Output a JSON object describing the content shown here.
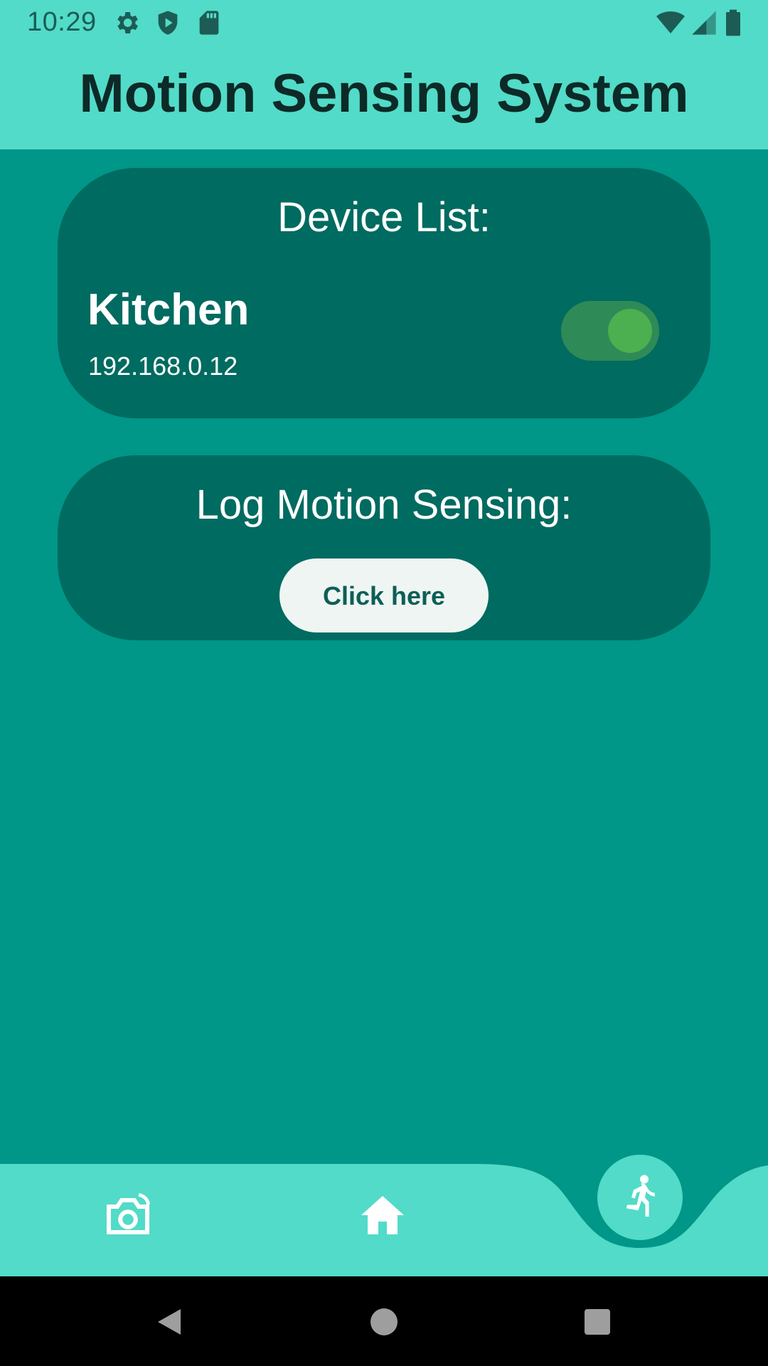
{
  "status_bar": {
    "time": "10:29",
    "left_icons": [
      "settings-icon",
      "shield-icon",
      "sd-card-icon"
    ],
    "right_icons": [
      "wifi-icon",
      "signal-icon",
      "battery-icon"
    ]
  },
  "app_bar": {
    "title": "Motion Sensing System"
  },
  "device_card": {
    "heading": "Device List:",
    "device": {
      "name": "Kitchen",
      "ip": "192.168.0.12",
      "enabled": true
    }
  },
  "log_card": {
    "heading": "Log Motion Sensing:",
    "button_label": "Click here"
  },
  "bottom_nav": {
    "items": [
      {
        "icon": "camera-icon"
      },
      {
        "icon": "home-icon"
      },
      {
        "icon": "running-person-icon",
        "selected": true
      }
    ]
  },
  "colors": {
    "background": "#009688",
    "mint": "#52dbc8",
    "card": "#006b60",
    "toggle_track": "#2e8b57",
    "toggle_knob": "#4caf50"
  },
  "system_nav": [
    "back-icon",
    "home-circle-icon",
    "recents-icon"
  ]
}
